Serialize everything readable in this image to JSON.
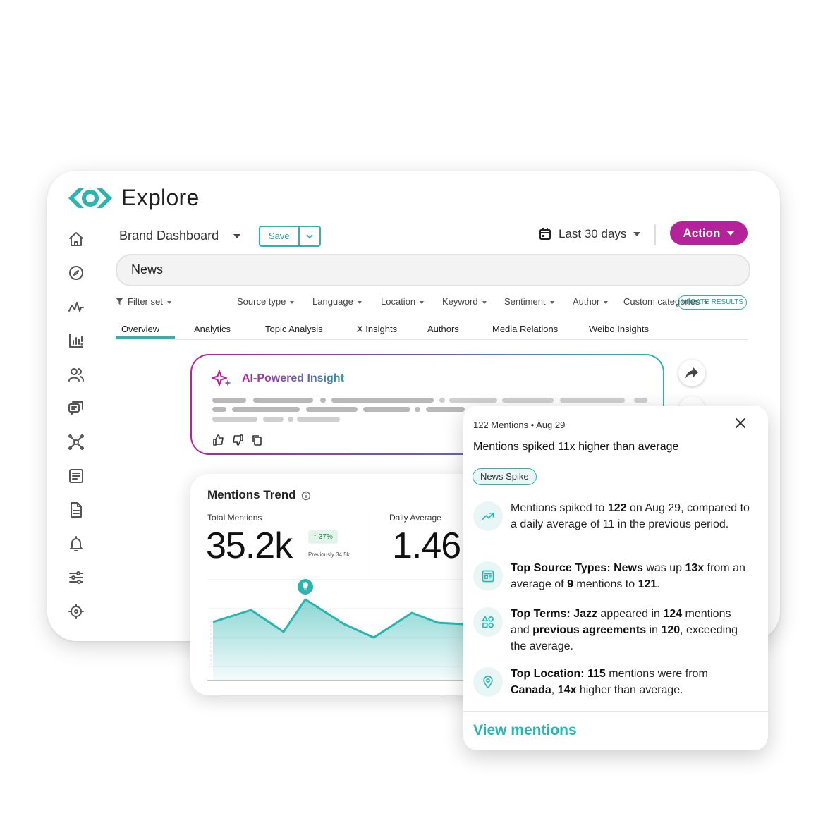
{
  "app": {
    "title": "Explore",
    "logo_icon": "eye-logo-icon",
    "brand_color": "#2bb5b0",
    "action_color": "#b5239a"
  },
  "sidebar": {
    "items": [
      {
        "name": "home",
        "icon": "home-icon"
      },
      {
        "name": "explore",
        "icon": "compass-icon"
      },
      {
        "name": "monitor",
        "icon": "pulse-icon"
      },
      {
        "name": "analytics",
        "icon": "bar-chart-alert-icon"
      },
      {
        "name": "audience",
        "icon": "users-icon"
      },
      {
        "name": "engage",
        "icon": "chat-icon"
      },
      {
        "name": "influencers",
        "icon": "network-icon"
      },
      {
        "name": "newsletters",
        "icon": "newspaper-icon"
      },
      {
        "name": "reports",
        "icon": "document-icon"
      },
      {
        "name": "alerts",
        "icon": "bell-icon"
      },
      {
        "name": "filters",
        "icon": "sliders-icon"
      },
      {
        "name": "settings",
        "icon": "gear-icon"
      }
    ]
  },
  "toolbar": {
    "dashboard_name": "Brand Dashboard",
    "save_label": "Save",
    "date_range": "Last 30 days",
    "action_label": "Action"
  },
  "search": {
    "query": "News"
  },
  "filters": {
    "items": [
      "Filter set",
      "Source type",
      "Language",
      "Location",
      "Keyword",
      "Sentiment",
      "Author",
      "Custom categories"
    ],
    "update_label": "UPDATE RESULTS"
  },
  "tabs": {
    "items": [
      "Overview",
      "Analytics",
      "Topic Analysis",
      "X Insights",
      "Authors",
      "Media Relations",
      "Weibo Insights"
    ],
    "active": "Overview"
  },
  "insight": {
    "title": "AI-Powered Insight"
  },
  "trend": {
    "title": "Mentions Trend",
    "total_label": "Total Mentions",
    "total_value": "35.2k",
    "change": "↑ 37%",
    "previously": "Previously 34.5k",
    "daily_label": "Daily Average",
    "daily_value": "1.46"
  },
  "popup": {
    "meta": "122 Mentions • Aug 29",
    "title": "Mentions spiked 11x higher than average",
    "badge": "News Spike",
    "view_label": "View mentions"
  }
}
